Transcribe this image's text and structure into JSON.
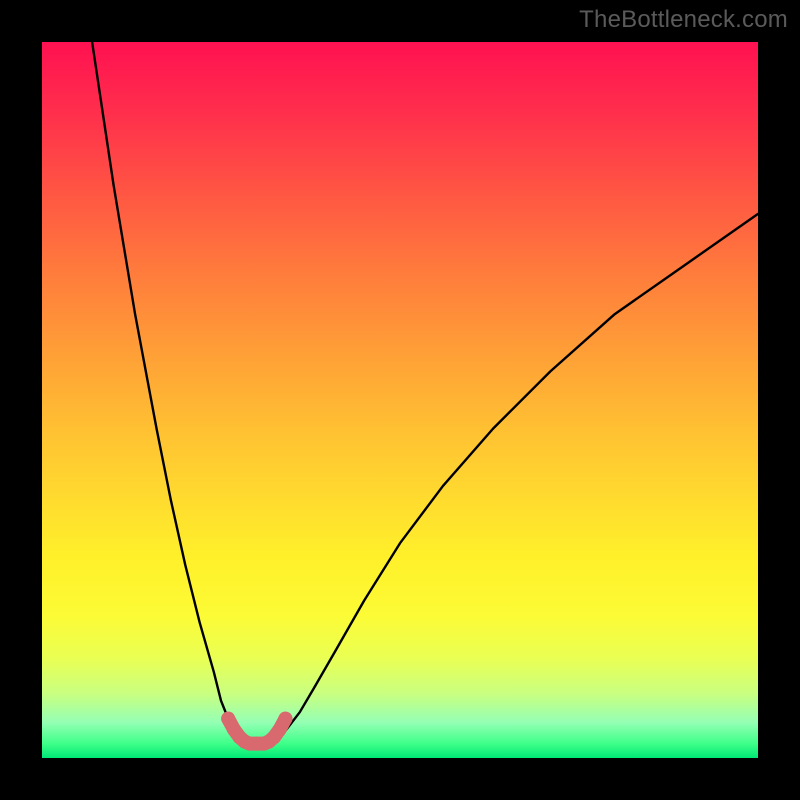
{
  "watermark": "TheBottleneck.com",
  "chart_data": {
    "type": "line",
    "title": "",
    "xlabel": "",
    "ylabel": "",
    "xlim": [
      0,
      100
    ],
    "ylim": [
      0,
      100
    ],
    "series": [
      {
        "name": "left-branch",
        "x": [
          7,
          10,
          13,
          16,
          18,
          20,
          22,
          24,
          25,
          26,
          27,
          28,
          29
        ],
        "y": [
          100,
          80,
          62,
          46,
          36,
          27,
          19,
          12,
          8,
          5.5,
          3.8,
          2.6,
          2.0
        ]
      },
      {
        "name": "right-branch",
        "x": [
          32,
          33,
          34,
          36,
          38,
          41,
          45,
          50,
          56,
          63,
          71,
          80,
          90,
          100
        ],
        "y": [
          2.0,
          2.6,
          3.8,
          6.4,
          9.8,
          15,
          22,
          30,
          38,
          46,
          54,
          62,
          69,
          76
        ]
      },
      {
        "name": "bottom-marker",
        "x": [
          26.0,
          26.8,
          27.6,
          28.3,
          29.0,
          30.0,
          31.0,
          31.7,
          32.4,
          33.2,
          34.0
        ],
        "y": [
          5.5,
          4.0,
          2.9,
          2.3,
          2.0,
          2.0,
          2.0,
          2.3,
          2.9,
          4.0,
          5.5
        ]
      }
    ],
    "styles": {
      "left-branch": {
        "stroke": "#000000",
        "width": 2.4,
        "dots": false
      },
      "right-branch": {
        "stroke": "#000000",
        "width": 2.4,
        "dots": false
      },
      "bottom-marker": {
        "stroke": "#d86a6f",
        "width": 14,
        "dots": true,
        "dot_r": 7
      }
    },
    "background_gradient": {
      "top": "#ff1151",
      "mid": "#ffd92e",
      "bottom": "#00e876"
    }
  }
}
